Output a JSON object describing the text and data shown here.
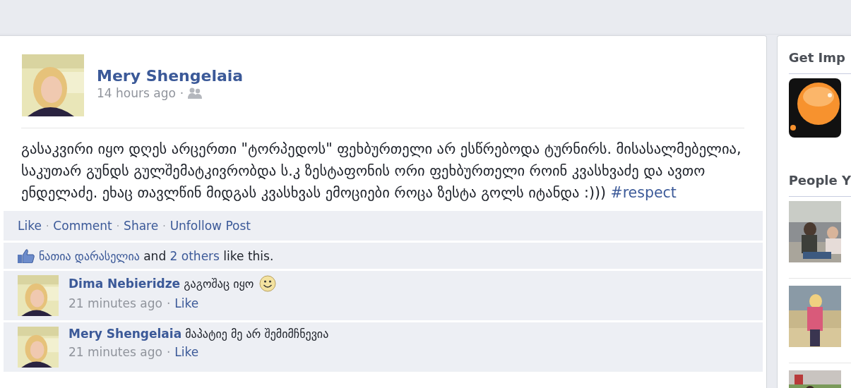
{
  "post": {
    "author": "Mery Shengelaia",
    "time": "14 hours ago",
    "audience_separator": "·",
    "text": "გასაკვირი იყო დღეს არცერთი \"ტორპედოს\" ფეხბურთელი არ ესწრებოდა ტურნირს. მისასალმებელია, საკუთარ გუნდს გულშემატკივრობდა ს.კ ზესტაფონის ორი ფეხბურთელი როინ კვასხვაძე და ავთო ენდელაძე. ეხაც თავლწინ მიდგას კვასხვას ემოციები როცა ზესტა გოლს იტანდა :)))",
    "hashtag": "#respect"
  },
  "action_separator": "·",
  "comment_separator": "·",
  "actions": [
    {
      "label": "Like"
    },
    {
      "label": "Comment"
    },
    {
      "label": "Share"
    },
    {
      "label": "Unfollow Post"
    }
  ],
  "likes": {
    "name": "ნათია დარასელია",
    "middle": "and",
    "others": "2 others",
    "end": "like this."
  },
  "comments": [
    {
      "author": "Dima Nebieridze",
      "text": "გაგოშაც იყო",
      "emoticon": true,
      "time": "21 minutes ago",
      "like": "Like"
    },
    {
      "author": "Mery Shengelaia",
      "text": "მაპატიე მე არ შემიმჩნევია",
      "emoticon": false,
      "time": "21 minutes ago",
      "like": "Like"
    }
  ],
  "sidebar": {
    "sections": [
      {
        "heading": "Get Imp",
        "items": [
          {
            "kind": "logo"
          }
        ]
      },
      {
        "heading": "People Y"
      }
    ]
  }
}
